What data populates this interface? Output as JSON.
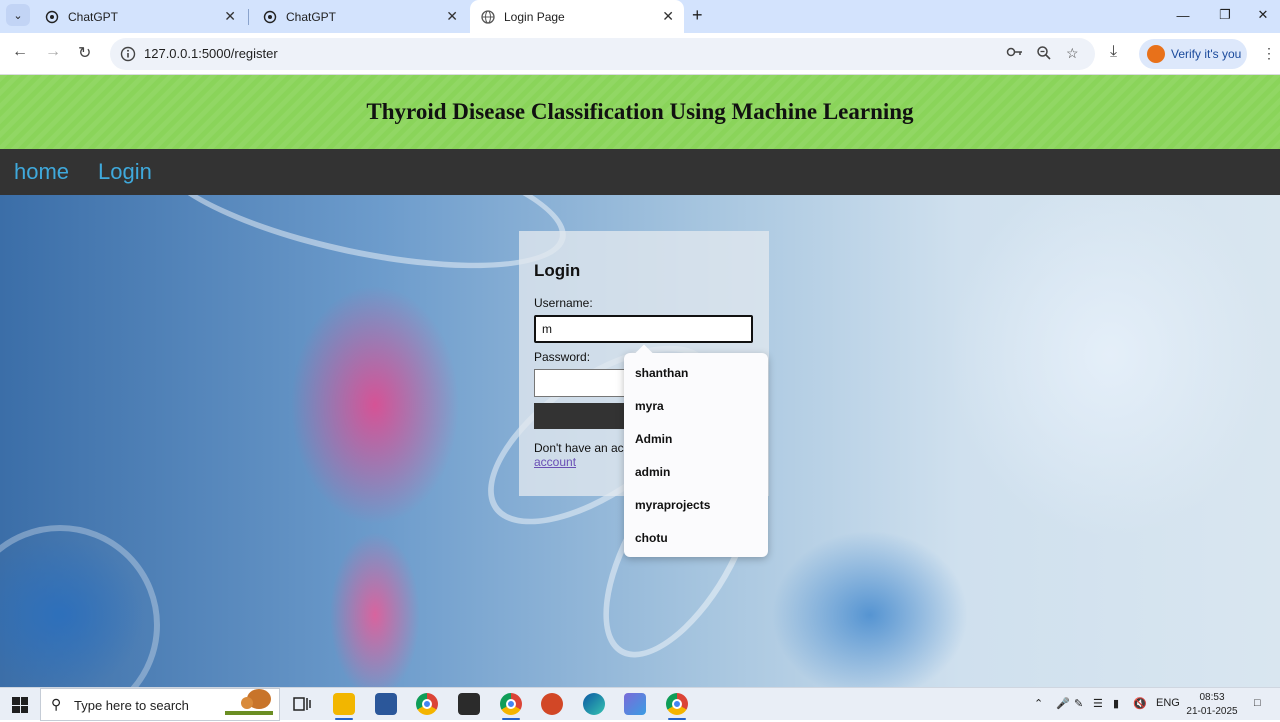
{
  "browser": {
    "tabs": [
      {
        "title": "ChatGPT",
        "active": false
      },
      {
        "title": "ChatGPT",
        "active": false
      },
      {
        "title": "Login Page",
        "active": true
      }
    ],
    "url": "127.0.0.1:5000/register",
    "verify_label": "Verify it's you"
  },
  "page": {
    "banner_title": "Thyroid Disease Classification Using Machine Learning",
    "nav": [
      {
        "label": "home"
      },
      {
        "label": "Login"
      }
    ],
    "login": {
      "title": "Login",
      "username_label": "Username:",
      "username_value": "m",
      "password_label": "Password:",
      "password_value": "",
      "no_account_text": "Don't have an acc",
      "register_link": "account"
    },
    "autocomplete": [
      "shanthan",
      "myra",
      "Admin",
      "admin",
      "myraprojects",
      "chotu"
    ]
  },
  "taskbar": {
    "search_placeholder": "Type here to search",
    "language": "ENG",
    "time": "08:53",
    "date": "21-01-2025"
  },
  "colors": {
    "banner": "#8ad45a",
    "navbar": "#333333",
    "nav_link": "#3fa9dc",
    "tabstrip": "#d3e3fd"
  }
}
